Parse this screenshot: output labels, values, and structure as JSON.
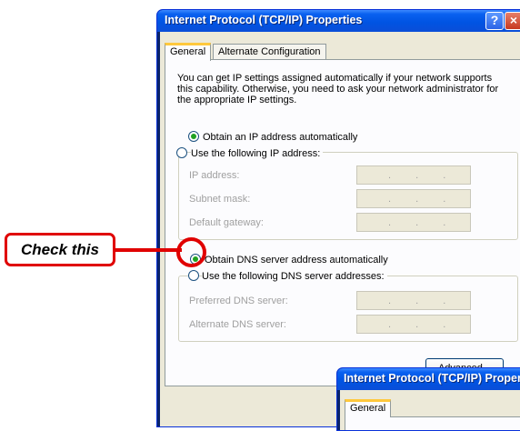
{
  "main_dialog": {
    "title": "Internet Protocol (TCP/IP) Properties",
    "help_glyph": "?",
    "close_glyph": "×",
    "tabs": [
      {
        "label": "General",
        "active": true
      },
      {
        "label": "Alternate Configuration",
        "active": false
      }
    ],
    "description": [
      "You can get IP settings assigned automatically if your network supports",
      "this capability. Otherwise, you need to ask your network administrator for",
      "the appropriate IP settings."
    ],
    "ip_auto": {
      "label": "Obtain an IP address automatically",
      "selected": true
    },
    "ip_manual": {
      "label": "Use the following IP address:",
      "selected": false
    },
    "ip_fields": [
      {
        "label": "IP address:",
        "value": ". . ."
      },
      {
        "label": "Subnet mask:",
        "value": ". . ."
      },
      {
        "label": "Default gateway:",
        "value": ". . ."
      }
    ],
    "dns_auto": {
      "label": "Obtain DNS server address automatically",
      "selected": true
    },
    "dns_manual": {
      "label": "Use the following DNS server addresses:",
      "selected": false
    },
    "dns_fields": [
      {
        "label": "Preferred DNS server:",
        "value": ". . ."
      },
      {
        "label": "Alternate DNS server:",
        "value": ". . ."
      }
    ],
    "advanced_button": "Advanced..."
  },
  "second_dialog": {
    "title": "Internet Protocol (TCP/IP) Properties",
    "tab": "General"
  },
  "callout": {
    "text": "Check this",
    "color": "#E00000"
  },
  "colors": {
    "titlebar": "#0054E3",
    "dialog_bg": "#ECE9D8",
    "active_tab_accent": "#FFC83C",
    "radio_dot": "#21A121"
  }
}
